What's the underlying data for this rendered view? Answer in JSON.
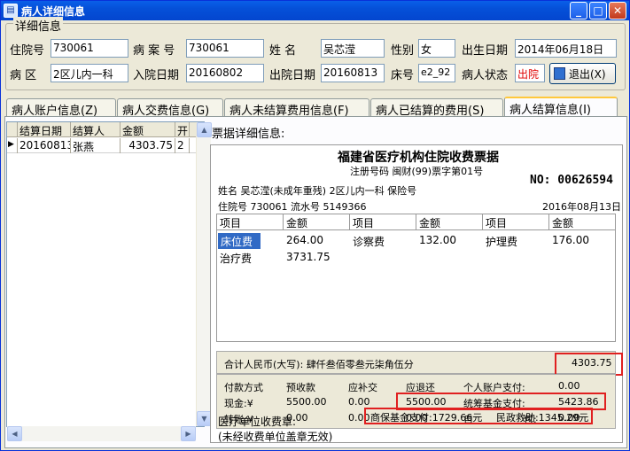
{
  "window": {
    "title": "病人详细信息",
    "minimize": "_",
    "maximize": "□",
    "close": "✕"
  },
  "details": {
    "group_title": "详细信息",
    "admission_no_label": "住院号",
    "admission_no": "730061",
    "case_no_label": "病 案 号",
    "case_no": "730061",
    "name_label": "姓    名",
    "name": "吴芯滢",
    "gender_label": "性别",
    "gender": "女",
    "birth_label": "出生日期",
    "birth": "2014年06月18日",
    "ward_label": "病    区",
    "ward": "2区儿内一科",
    "admit_date_label": "入院日期",
    "admit_date": "20160802",
    "discharge_date_label": "出院日期",
    "discharge_date": "20160813",
    "bed_label": "床号",
    "bed": "e2_92",
    "status_label": "病人状态",
    "status": "出院",
    "exit_button": "退出(X)"
  },
  "tabs": [
    "病人账户信息(Z)",
    "病人交费信息(G)",
    "病人未结算费用信息(F)",
    "病人已结算的费用(S)",
    "病人结算信息(I)"
  ],
  "settle_grid": {
    "columns": [
      "结算日期",
      "结算人",
      "金额",
      "开"
    ],
    "rows": [
      {
        "date": "20160813",
        "person": "张燕",
        "amount": "4303.75",
        "extra": "2"
      }
    ]
  },
  "receipt": {
    "panel_title": "票据详细信息:",
    "title": "福建省医疗机构住院收费票据",
    "reg_line": "注册号码  闽财(99)票字第01号",
    "no": "NO: 00626594",
    "name_line": "姓名    吴芯滢(未成年重残)    2区儿内一科    保险号",
    "adm_line": "住院号  730061      流水号   5149366",
    "date": "2016年08月13日",
    "bill_headers": [
      "项目",
      "金额",
      "项目",
      "金额",
      "项目",
      "金额"
    ],
    "bill_rows": [
      [
        "床位费",
        "264.00",
        "诊察费",
        "132.00",
        "护理费",
        "176.00"
      ],
      [
        "治疗费",
        "3731.75",
        "",
        "",
        "",
        ""
      ]
    ],
    "total_label": "合计人民币(大写):  肆仟叁佰零叁元柒角伍分",
    "total_value": "4303.75",
    "pay": {
      "h_method": "付款方式",
      "h_prepaid": "预收款",
      "h_supplement": "应补交",
      "h_refund": "应退还",
      "h_personal": "个人账户支付:",
      "personal_value": "0.00",
      "cash_label": "现金:¥",
      "cash_prepaid": "5500.00",
      "cash_supplement": "0.00",
      "cash_refund": "5500.00",
      "pool_label": "统筹基金支付:",
      "pool_value": "5423.86",
      "transfer_label": "转账:¥",
      "tr_prepaid": "0.00",
      "tr_supplement": "0.00",
      "tr_refund": "0.00",
      "self_label": "自",
      "self_pay_label": "付:",
      "self_pay_value": "0.00"
    },
    "footer_stamp": "医疗单位收费章:",
    "footer_note": "(未经收费单位盖章无效)",
    "commercial": "商保基金支付:1729.66元",
    "civil": "民政救助:1345.29元"
  }
}
